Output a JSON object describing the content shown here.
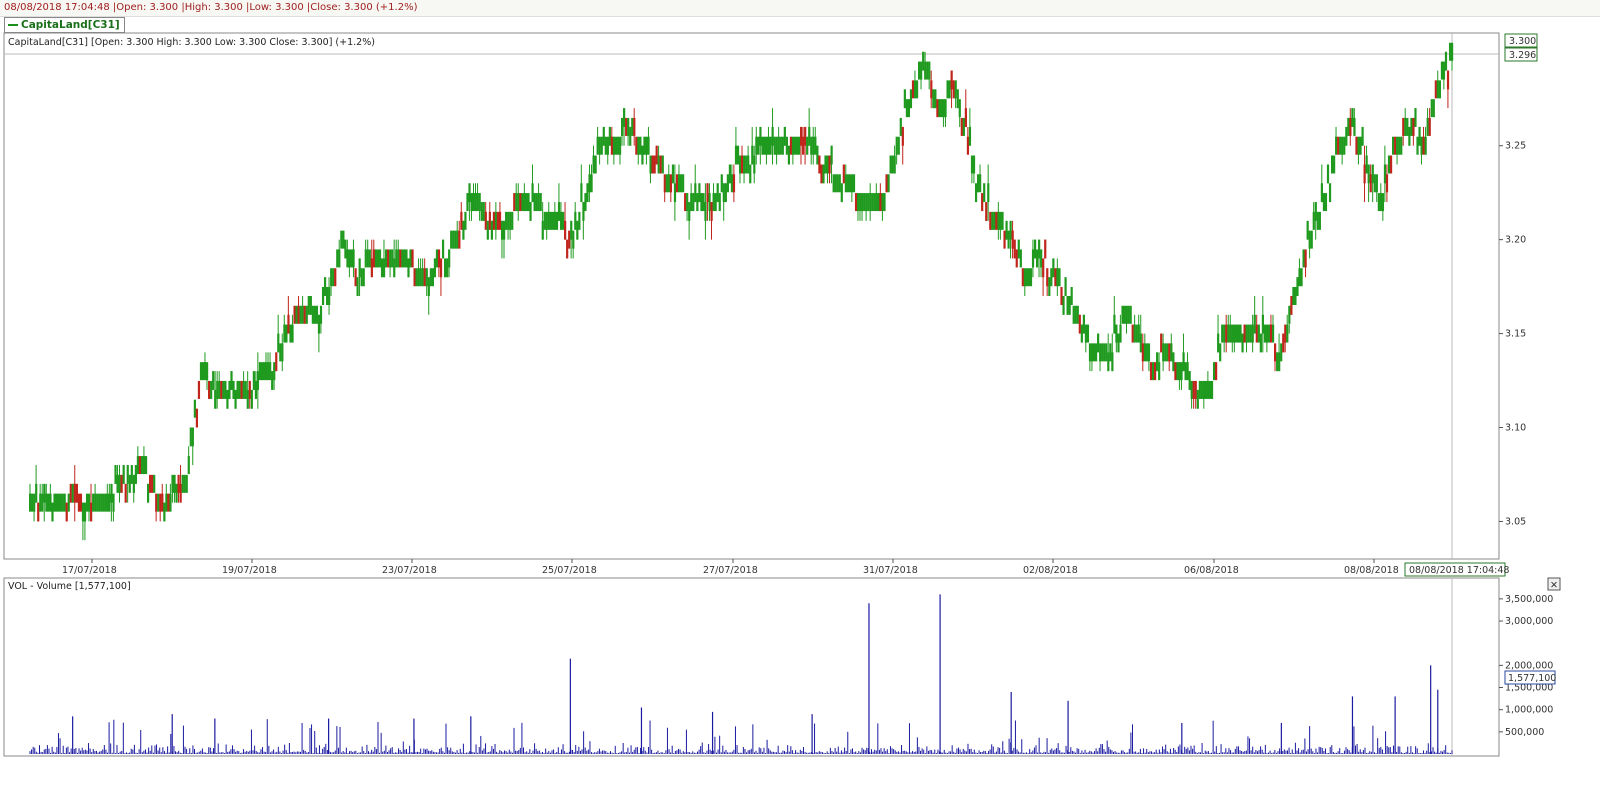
{
  "header": {
    "info": "08/08/2018 17:04:48 |Open: 3.300 |High: 3.300 |Low: 3.300 |Close: 3.300 (+1.2%)",
    "legend": "CapitaLand[C31]"
  },
  "price_panel": {
    "caption": "CapitaLand[C31] [Open: 3.300  High: 3.300  Low: 3.300  Close: 3.300] (+1.2%)",
    "last_tag": "3.300",
    "crosshair_tag": "3.296",
    "time_tag": "08/08/2018 17:04:48"
  },
  "volume_panel": {
    "caption": "VOL - Volume [1,577,100]",
    "last_tag": "1,577,100",
    "close_glyph": "✕"
  },
  "colors": {
    "up": "#1f9a1f",
    "down": "#c0241a",
    "line": "#2a7a2a",
    "volume": "#1a1aa0"
  },
  "chart_data": [
    {
      "type": "candlestick",
      "title": "CapitaLand[C31]",
      "x_tick_labels": [
        "17/07/2018",
        "19/07/2018",
        "23/07/2018",
        "25/07/2018",
        "27/07/2018",
        "31/07/2018",
        "02/08/2018",
        "06/08/2018",
        "08/08/2018"
      ],
      "y_tick_labels": [
        "3.05",
        "3.10",
        "3.15",
        "3.20",
        "3.25"
      ],
      "ylim": [
        3.03,
        3.31
      ],
      "close_path_points": [
        [
          0,
          3.06
        ],
        [
          0.01,
          3.06
        ],
        [
          0.03,
          3.055
        ],
        [
          0.05,
          3.06
        ],
        [
          0.07,
          3.07
        ],
        [
          0.08,
          3.08
        ],
        [
          0.09,
          3.06
        ],
        [
          0.1,
          3.065
        ],
        [
          0.11,
          3.07
        ],
        [
          0.115,
          3.1
        ],
        [
          0.12,
          3.13
        ],
        [
          0.13,
          3.12
        ],
        [
          0.15,
          3.12
        ],
        [
          0.17,
          3.13
        ],
        [
          0.18,
          3.15
        ],
        [
          0.19,
          3.16
        ],
        [
          0.2,
          3.16
        ],
        [
          0.21,
          3.17
        ],
        [
          0.22,
          3.2
        ],
        [
          0.23,
          3.18
        ],
        [
          0.24,
          3.19
        ],
        [
          0.26,
          3.19
        ],
        [
          0.28,
          3.18
        ],
        [
          0.3,
          3.2
        ],
        [
          0.31,
          3.22
        ],
        [
          0.33,
          3.21
        ],
        [
          0.35,
          3.22
        ],
        [
          0.37,
          3.21
        ],
        [
          0.38,
          3.2
        ],
        [
          0.39,
          3.22
        ],
        [
          0.4,
          3.25
        ],
        [
          0.41,
          3.25
        ],
        [
          0.42,
          3.26
        ],
        [
          0.44,
          3.24
        ],
        [
          0.45,
          3.23
        ],
        [
          0.47,
          3.22
        ],
        [
          0.48,
          3.22
        ],
        [
          0.5,
          3.24
        ],
        [
          0.52,
          3.25
        ],
        [
          0.55,
          3.25
        ],
        [
          0.57,
          3.23
        ],
        [
          0.59,
          3.22
        ],
        [
          0.6,
          3.22
        ],
        [
          0.61,
          3.25
        ],
        [
          0.62,
          3.28
        ],
        [
          0.63,
          3.29
        ],
        [
          0.635,
          3.28
        ],
        [
          0.64,
          3.27
        ],
        [
          0.65,
          3.28
        ],
        [
          0.66,
          3.25
        ],
        [
          0.67,
          3.22
        ],
        [
          0.68,
          3.21
        ],
        [
          0.69,
          3.2
        ],
        [
          0.7,
          3.18
        ],
        [
          0.71,
          3.19
        ],
        [
          0.72,
          3.18
        ],
        [
          0.73,
          3.17
        ],
        [
          0.74,
          3.15
        ],
        [
          0.75,
          3.14
        ],
        [
          0.76,
          3.14
        ],
        [
          0.77,
          3.16
        ],
        [
          0.78,
          3.15
        ],
        [
          0.79,
          3.13
        ],
        [
          0.8,
          3.14
        ],
        [
          0.81,
          3.13
        ],
        [
          0.82,
          3.12
        ],
        [
          0.83,
          3.12
        ],
        [
          0.84,
          3.15
        ],
        [
          0.85,
          3.15
        ],
        [
          0.87,
          3.15
        ],
        [
          0.88,
          3.14
        ],
        [
          0.89,
          3.17
        ],
        [
          0.9,
          3.2
        ],
        [
          0.91,
          3.22
        ],
        [
          0.92,
          3.25
        ],
        [
          0.93,
          3.26
        ],
        [
          0.94,
          3.24
        ],
        [
          0.95,
          3.22
        ],
        [
          0.96,
          3.25
        ],
        [
          0.97,
          3.26
        ],
        [
          0.98,
          3.25
        ],
        [
          0.99,
          3.28
        ],
        [
          1.0,
          3.3
        ]
      ]
    },
    {
      "type": "bar",
      "title": "VOL - Volume [1,577,100]",
      "y_tick_labels": [
        "500,000",
        "1,000,000",
        "1,500,000",
        "2,000,000",
        "3,000,000",
        "3,500,000"
      ],
      "ylim": [
        0,
        3700000
      ],
      "last_value": 1577100,
      "notable_spikes": [
        [
          0.03,
          850000
        ],
        [
          0.1,
          900000
        ],
        [
          0.13,
          800000
        ],
        [
          0.21,
          800000
        ],
        [
          0.27,
          800000
        ],
        [
          0.31,
          850000
        ],
        [
          0.38,
          2150000
        ],
        [
          0.43,
          1050000
        ],
        [
          0.48,
          950000
        ],
        [
          0.55,
          900000
        ],
        [
          0.59,
          3400000
        ],
        [
          0.64,
          3600000
        ],
        [
          0.69,
          1400000
        ],
        [
          0.73,
          1200000
        ],
        [
          0.81,
          700000
        ],
        [
          0.88,
          700000
        ],
        [
          0.93,
          1300000
        ],
        [
          0.96,
          1300000
        ],
        [
          0.985,
          2000000
        ],
        [
          0.99,
          1450000
        ]
      ]
    }
  ]
}
